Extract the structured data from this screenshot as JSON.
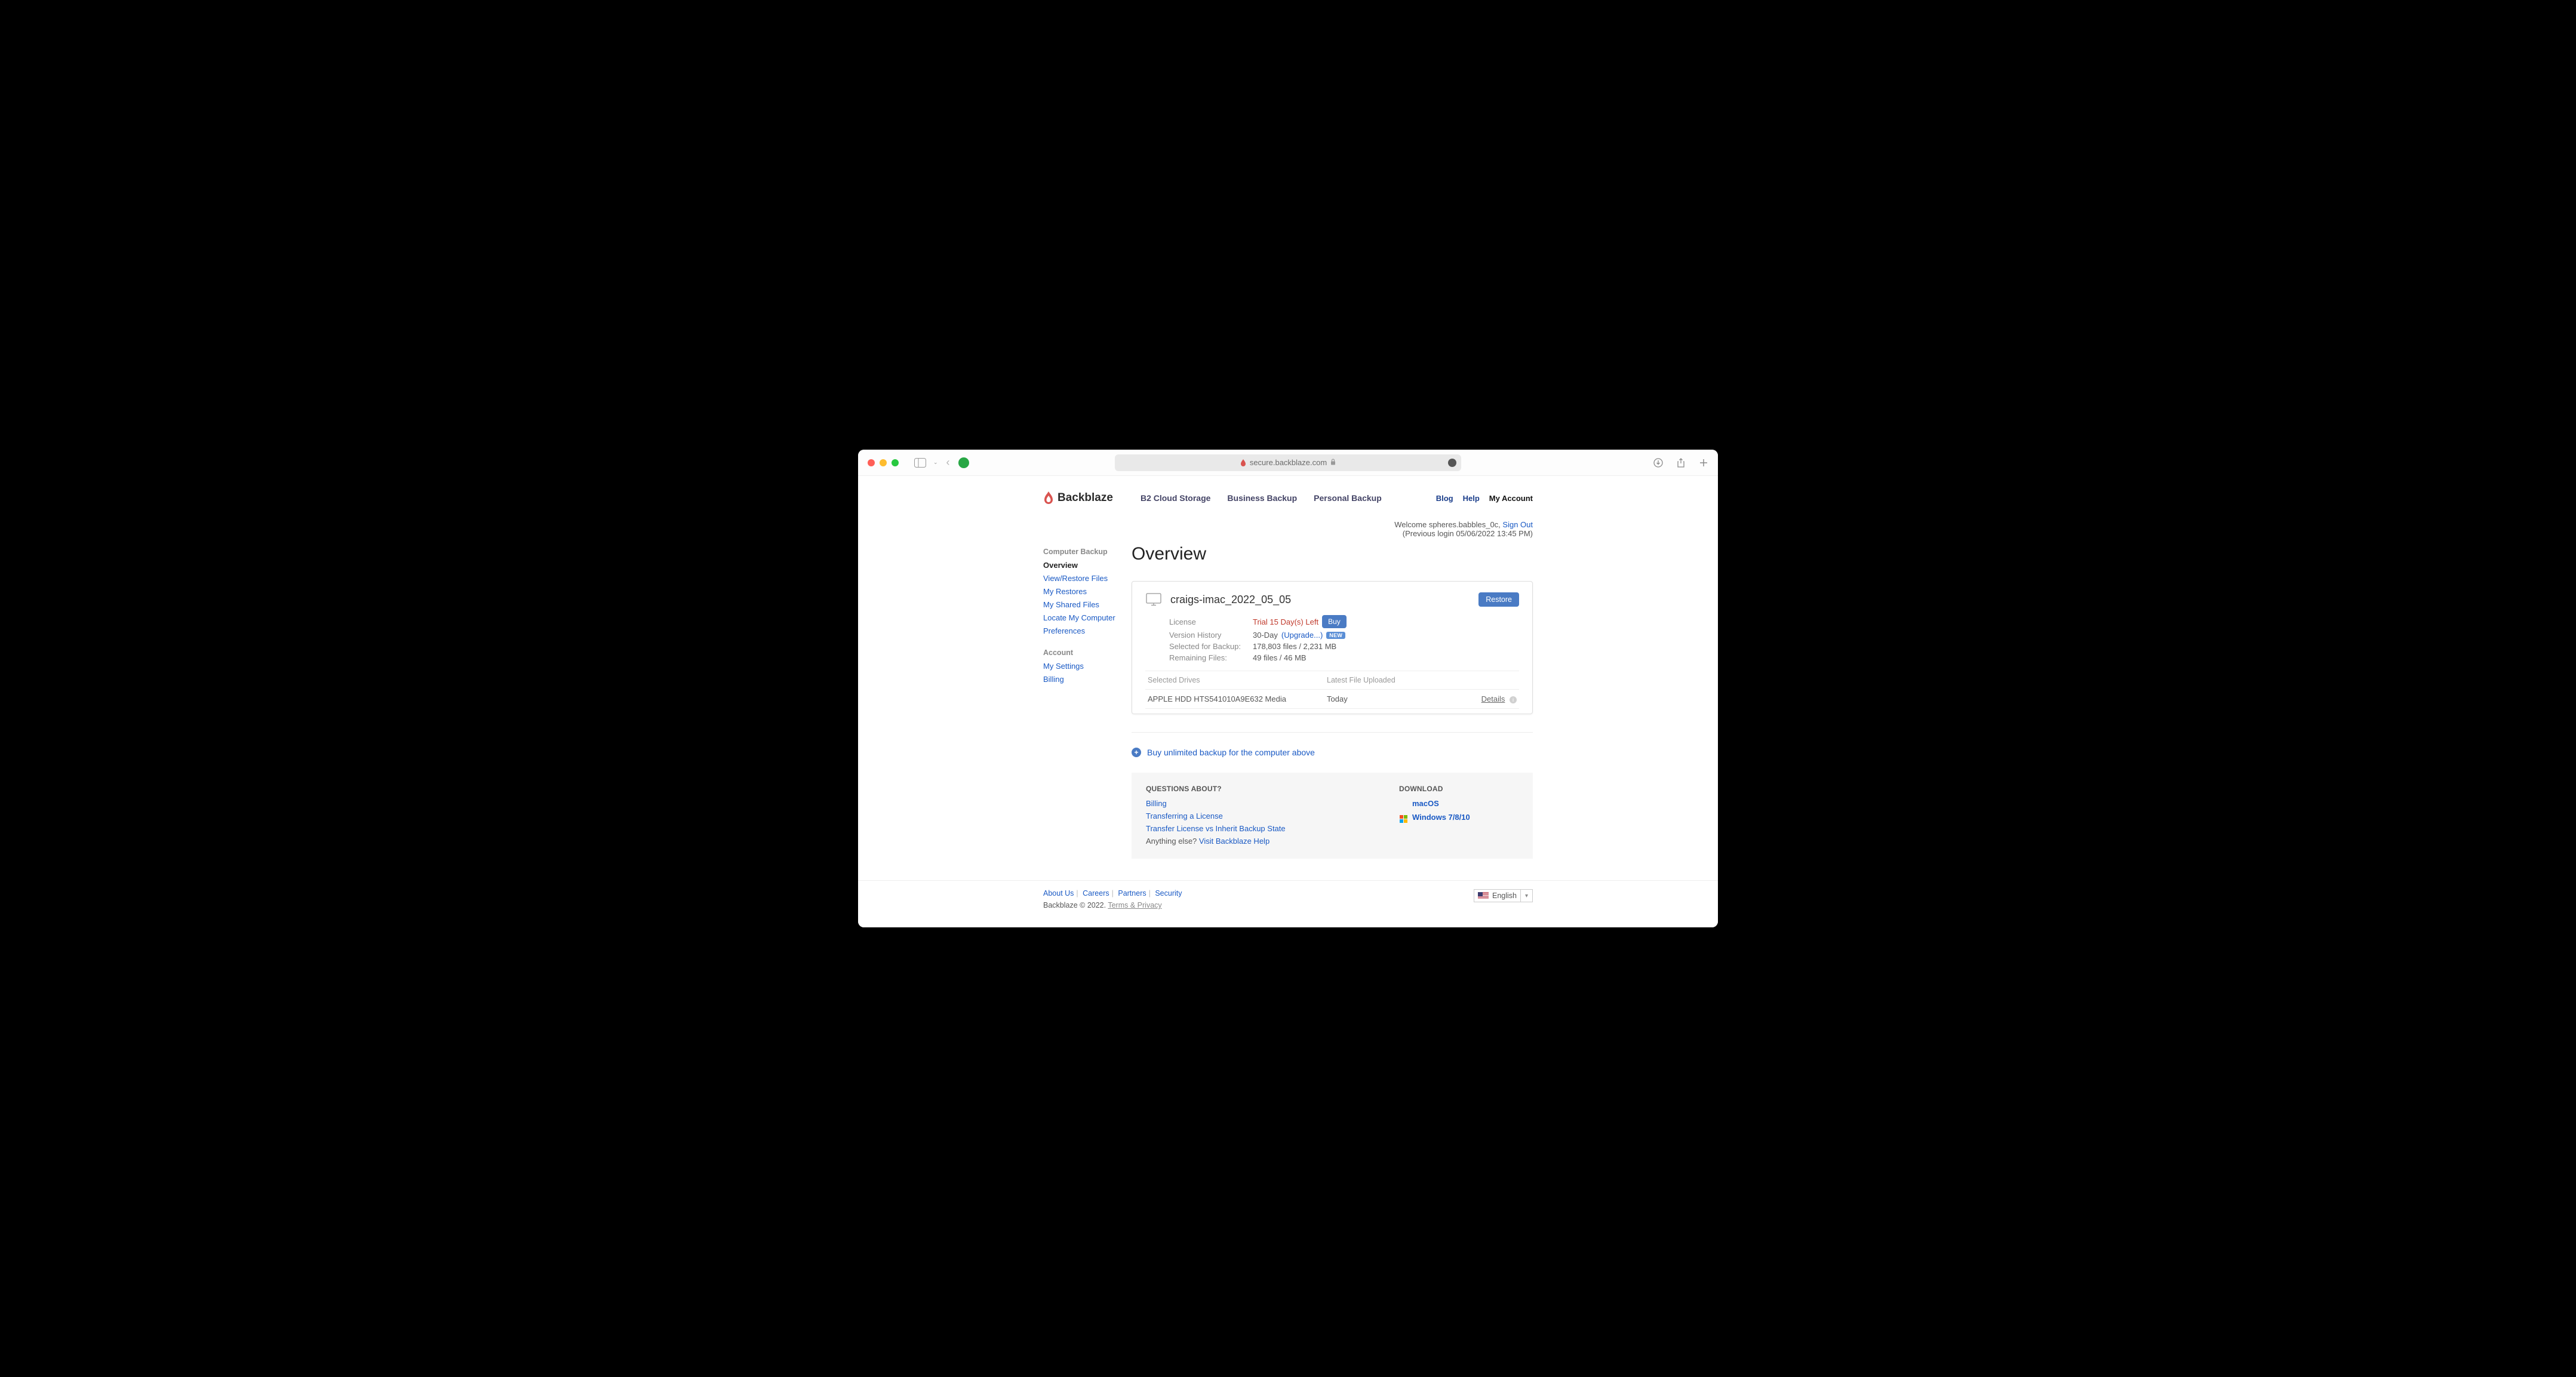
{
  "browser": {
    "url": "secure.backblaze.com"
  },
  "nav": {
    "brand": "Backblaze",
    "links": [
      "B2 Cloud Storage",
      "Business Backup",
      "Personal Backup"
    ],
    "right": [
      "Blog",
      "Help",
      "My Account"
    ]
  },
  "welcome": {
    "prefix": "Welcome ",
    "user": "spheres.babbles_0c",
    "signout_sep": ", ",
    "signout": "Sign Out",
    "previous": "(Previous login 05/06/2022 13:45 PM)"
  },
  "sidebar": {
    "heads": {
      "backup": "Computer Backup",
      "account": "Account"
    },
    "backup_items": [
      "Overview",
      "View/Restore Files",
      "My Restores",
      "My Shared Files",
      "Locate My Computer",
      "Preferences"
    ],
    "account_items": [
      "My Settings",
      "Billing"
    ]
  },
  "page_title": "Overview",
  "computer": {
    "name": "craigs-imac_2022_05_05",
    "restore_btn": "Restore",
    "rows": {
      "license_label": "License",
      "license_val": "Trial 15 Day(s) Left",
      "buy_btn": "Buy",
      "vh_label": "Version History",
      "vh_val": "30-Day",
      "vh_upgrade": "(Upgrade...)",
      "vh_badge": "NEW",
      "selected_label": "Selected for Backup:",
      "selected_val": "178,803 files / 2,231 MB",
      "remaining_label": "Remaining Files:",
      "remaining_val": "49 files / 46 MB"
    },
    "drives": {
      "head_drive": "Selected Drives",
      "head_latest": "Latest File Uploaded",
      "rows": [
        {
          "name": "APPLE HDD HTS541010A9E632 Media",
          "latest": "Today",
          "details": "Details"
        }
      ]
    }
  },
  "buy_unlimited": "Buy unlimited backup for the computer above",
  "questions": {
    "head": "QUESTIONS ABOUT?",
    "links": [
      "Billing",
      "Transferring a License",
      "Transfer License vs Inherit Backup State"
    ],
    "else_prefix": "Anything else? ",
    "else_link": "Visit Backblaze Help"
  },
  "download": {
    "head": "DOWNLOAD",
    "mac": "macOS",
    "win": "Windows 7/8/10"
  },
  "footer": {
    "links": [
      "About Us",
      "Careers",
      "Partners",
      "Security"
    ],
    "copyright": "Backblaze © 2022. ",
    "terms": "Terms & Privacy",
    "lang": "English"
  }
}
